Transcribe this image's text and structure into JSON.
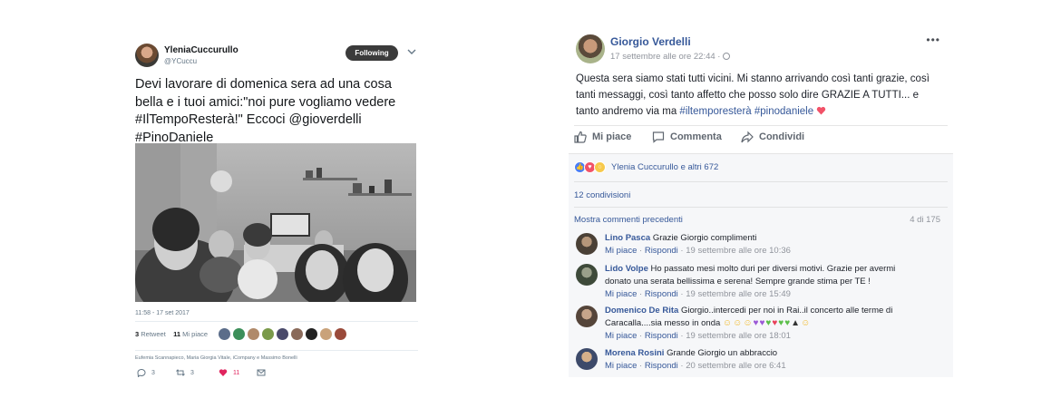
{
  "tweet": {
    "display_name": "YleniaCuccurullo",
    "handle": "@YCuccu",
    "follow_label": "Following",
    "text_lines": [
      "Devi lavorare di domenica sera ad una cosa",
      "bella e i tuoi amici:\"noi pure vogliamo vedere",
      "#IlTempoResterà!\" Eccoci @gioverdelli",
      "#PinoDaniele"
    ],
    "timestamp": "11:58 - 17 set 2017",
    "retweets_count": "3",
    "retweets_label": "Retweet",
    "likes_count": "11",
    "likes_label": "Mi piace",
    "thread_text": "Eufemia Scannapieco, Maria Giorgia Vitale, iCompany e Massimo Bonelli",
    "actions": {
      "reply": "3",
      "retweet": "3",
      "like": "11"
    },
    "colors": {
      "follow_bg": "#3b3b3b",
      "like": "#e0245e"
    }
  },
  "fb": {
    "author": "Giorgio Verdelli",
    "date": "17 settembre alle ore 22:44",
    "more": "•••",
    "text_parts": {
      "line1": "Questa sera siamo stati tutti vicini. Mi stanno arrivando così tanti grazie, così",
      "line2": "tanti messaggi, così tanto affetto che posso solo dire GRAZIE A TUTTI... e",
      "line3_a": "tanto andremo via ma ",
      "tag1": "#iltemporesterà",
      "tag2": "#pinodaniele"
    },
    "actions": {
      "like": "Mi piace",
      "comment": "Commenta",
      "share": "Condividi"
    },
    "reactions_text": "Ylenia Cuccurullo e altri 672",
    "shares_text": "12 condivisioni",
    "prev_comments": "Mostra commenti precedenti",
    "comments_count": "4 di 175",
    "comment_like": "Mi piace",
    "comment_reply": "Rispondi",
    "comments": [
      {
        "name": "Lino Pasca",
        "text1": "Grazie Giorgio complimenti",
        "text2": "",
        "time": "19 settembre alle ore 10:36"
      },
      {
        "name": "Lido Volpe",
        "text1": "Ho passato mesi molto duri per diversi motivi. Grazie per avermi",
        "text2": "donato una serata bellissima e serena! Sempre grande stima per TE !",
        "time": "19 settembre alle ore 15:49"
      },
      {
        "name": "Domenico De Rita",
        "text1": "Giorgio..intercedi per noi in Rai..il concerto alle terme di",
        "text2": "Caracalla....sia messo in onda",
        "time": "19 settembre alle ore 18:01"
      },
      {
        "name": "Morena Rosini",
        "text1": "Grande Giorgio un abbraccio",
        "text2": "",
        "time": "20 settembre alle ore 6:41"
      }
    ],
    "colors": {
      "link": "#365899",
      "muted": "#90949c",
      "panel": "#f6f7f9"
    }
  }
}
